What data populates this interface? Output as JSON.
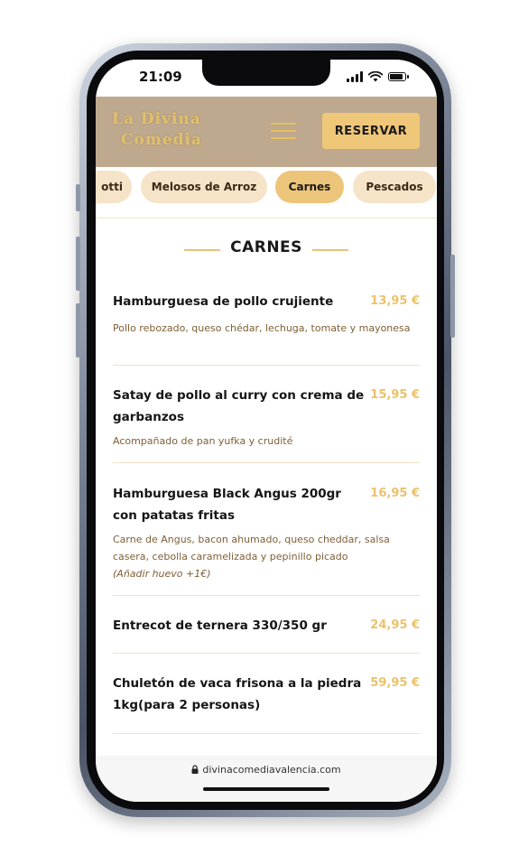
{
  "status_bar": {
    "time": "21:09",
    "icons": [
      "signal-icon",
      "wifi-icon",
      "battery-icon"
    ]
  },
  "header": {
    "logo_line1": "La Divina",
    "logo_line2": "Comedia",
    "menu_icon": "hamburger-icon",
    "reserve_label": "RESERVAR"
  },
  "tabs": [
    {
      "label": "otti",
      "active": false
    },
    {
      "label": "Melosos de Arroz",
      "active": false
    },
    {
      "label": "Carnes",
      "active": true
    },
    {
      "label": "Pescados",
      "active": false
    }
  ],
  "section": {
    "title": "CARNES"
  },
  "menu_items": [
    {
      "name": "Hamburguesa de pollo crujiente",
      "price": "13,95 €",
      "description": "Pollo rebozado, queso chédar, lechuga, tomate y mayonesa"
    },
    {
      "name": "Satay de pollo al curry con crema de garbanzos",
      "price": "15,95 €",
      "description": "Acompañado de pan yufka y crudité"
    },
    {
      "name": "Hamburguesa Black Angus 200gr con patatas fritas",
      "price": "16,95 €",
      "description": "Carne de Angus, bacon ahumado, queso cheddar, salsa casera, cebolla caramelizada y pepinillo picado",
      "note": "(Añadir huevo +1€)"
    },
    {
      "name": "Entrecot de ternera 330/350 gr",
      "price": "24,95 €"
    },
    {
      "name": "Chuletón de vaca frisona a la piedra 1kg(para 2 personas)",
      "price": "59,95 €"
    }
  ],
  "browser": {
    "url": "divinacomediavalencia.com"
  },
  "colors": {
    "header_bg": "#bea98f",
    "accent_gold": "#edc57a",
    "price": "#ecc16c",
    "description": "#7e5f35",
    "tab_bg": "#f6e4c8"
  }
}
